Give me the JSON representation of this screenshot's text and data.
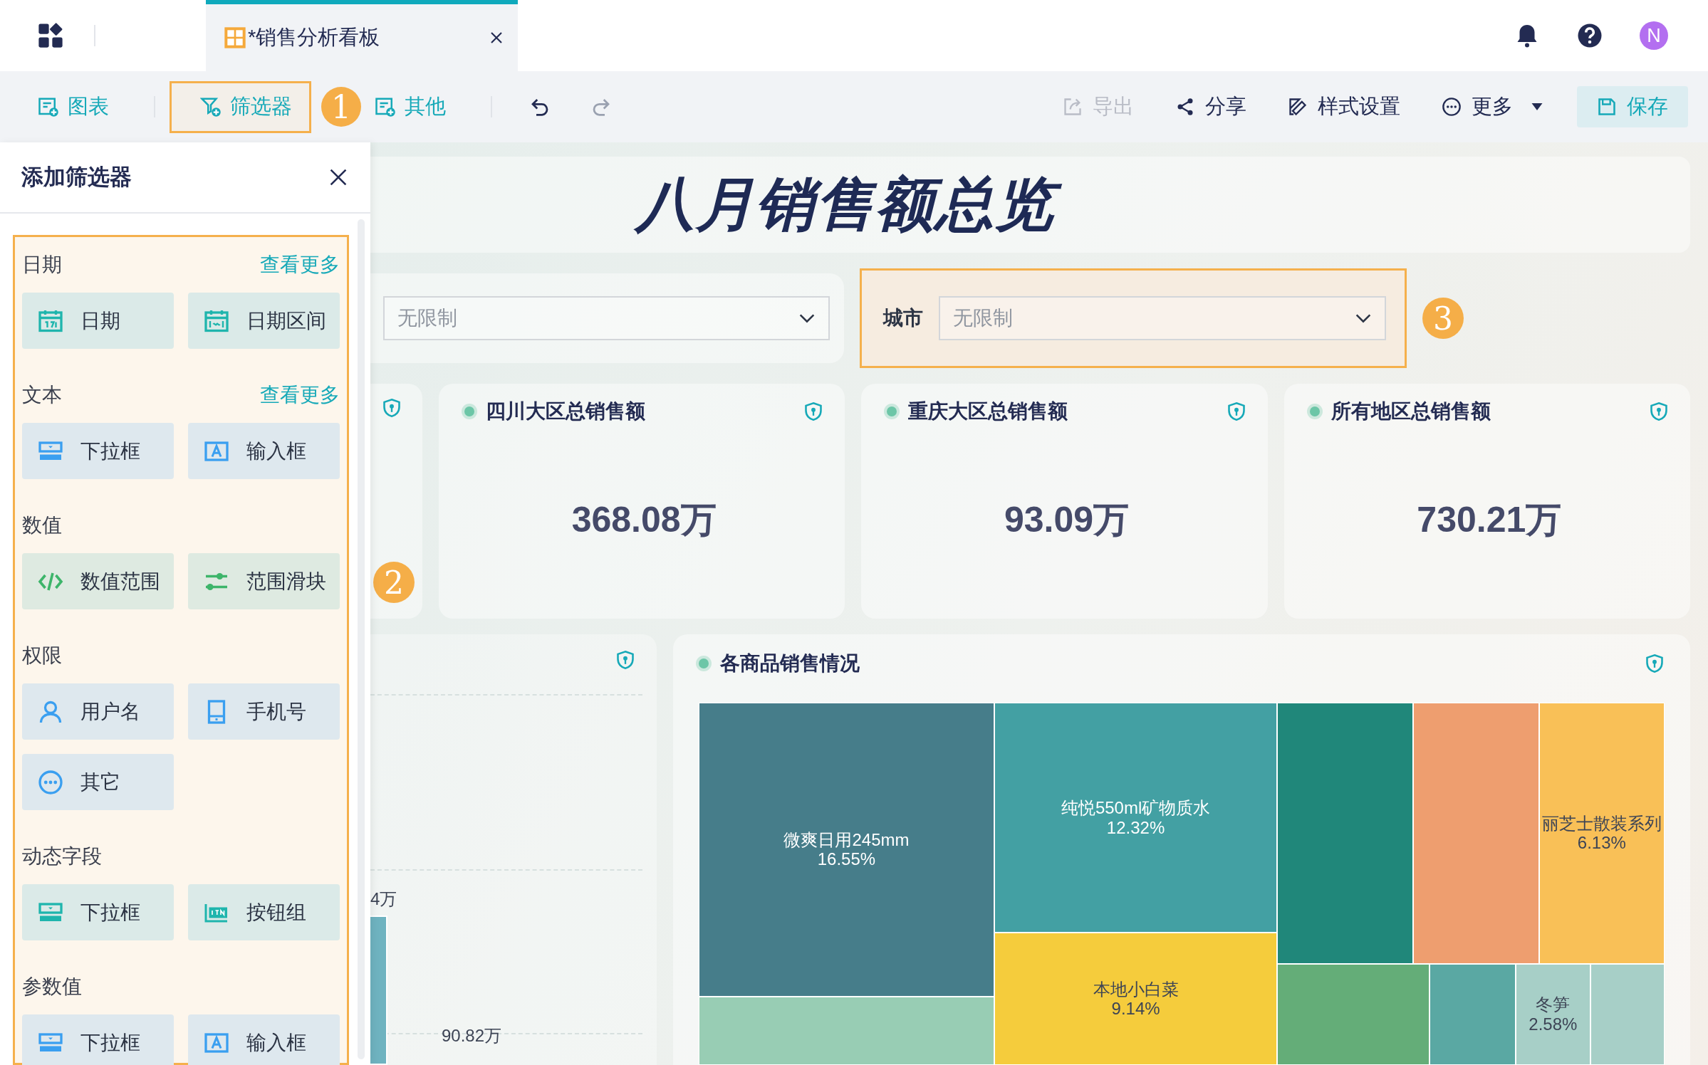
{
  "app_bar": {
    "tab": {
      "title": "*销售分析看板",
      "selected": true
    },
    "avatar": "N"
  },
  "toolbar": {
    "left": [
      {
        "kind": "chart",
        "label": "图表",
        "selected": false
      },
      {
        "kind": "filter",
        "label": "筛选器",
        "selected": true
      },
      {
        "kind": "other",
        "label": "其他",
        "selected": false
      }
    ],
    "callout": "1",
    "history": [
      {
        "kind": "undo",
        "disabled": false
      },
      {
        "kind": "redo",
        "disabled": true
      }
    ],
    "right": [
      {
        "kind": "export",
        "label": "导出",
        "disabled": true
      },
      {
        "kind": "share",
        "label": "分享",
        "disabled": false
      },
      {
        "kind": "style",
        "label": "样式设置",
        "disabled": false
      },
      {
        "kind": "more",
        "label": "更多",
        "disabled": false
      }
    ],
    "save": "保存"
  },
  "filter_panel": {
    "title": "添加筛选器",
    "sections": [
      {
        "title": "日期",
        "more": "查看更多",
        "items": [
          {
            "kind": "calendar",
            "label": "日期",
            "color": "#1fb5ad"
          },
          {
            "kind": "calendar-range",
            "label": "日期区间",
            "color": "#1fb5ad"
          }
        ]
      },
      {
        "title": "文本",
        "more": "查看更多",
        "items": [
          {
            "kind": "dropdown",
            "label": "下拉框",
            "color": "#3a9ff0"
          },
          {
            "kind": "input",
            "label": "输入框",
            "color": "#3a9ff0"
          }
        ]
      },
      {
        "title": "数值",
        "items": [
          {
            "kind": "code",
            "label": "数值范围",
            "color": "#3db56a"
          },
          {
            "kind": "slider",
            "label": "范围滑块",
            "color": "#3db56a"
          }
        ]
      },
      {
        "title": "权限",
        "items": [
          {
            "kind": "user",
            "label": "用户名",
            "color": "#3a9ff0"
          },
          {
            "kind": "phone",
            "label": "手机号",
            "color": "#3a9ff0"
          },
          {
            "kind": "dots",
            "label": "其它",
            "color": "#3a9ff0"
          }
        ]
      },
      {
        "title": "动态字段",
        "items": [
          {
            "kind": "dropdown",
            "label": "下拉框",
            "color": "#1fb5ad"
          },
          {
            "kind": "button-group",
            "label": "按钮组",
            "color": "#1fb5ad"
          }
        ]
      },
      {
        "title": "参数值",
        "items": [
          {
            "kind": "dropdown",
            "label": "下拉框",
            "color": "#3a9ff0"
          },
          {
            "kind": "input",
            "label": "输入框",
            "color": "#3a9ff0"
          }
        ]
      }
    ]
  },
  "dashboard": {
    "title": "八月销售额总览",
    "filters": [
      {
        "placeholder": "无限制",
        "highlighted": false
      },
      {
        "label": "城市",
        "placeholder": "无限制",
        "highlighted": true
      }
    ],
    "filter_callout": "3",
    "kpi_callout": "2",
    "kpis": [
      {
        "title": "四川大区总销售额",
        "value": "368.08万"
      },
      {
        "title": "重庆大区总销售额",
        "value": "93.09万"
      },
      {
        "title": "所有地区总销售额",
        "value": "730.21万"
      }
    ],
    "bar_chart_fragment": {
      "value_labels": [
        "4万",
        "90.82万"
      ]
    },
    "treemap": {
      "title": "各商品销售情况",
      "tiles": [
        {
          "label": "微爽日用245mm",
          "share": "16.55%",
          "color": "#467d8a"
        },
        {
          "color": "#98cdb4"
        },
        {
          "label": "纯悦550ml矿物质水",
          "share": "12.32%",
          "color": "#43a0a3"
        },
        {
          "label": "本地小白菜",
          "share": "9.14%",
          "color": "#f5cc3c"
        },
        {
          "color": "#20877a"
        },
        {
          "color": "#ee9e6f"
        },
        {
          "label": "丽芝士散装系列",
          "share": "6.13%",
          "color": "#f9c057"
        },
        {
          "color": "#64ad78"
        },
        {
          "color": "#5aa8a3"
        },
        {
          "label": "冬笋",
          "share": "2.58%",
          "color": "#a7cfc7"
        },
        {
          "color": "#a7cfc7"
        }
      ]
    }
  }
}
